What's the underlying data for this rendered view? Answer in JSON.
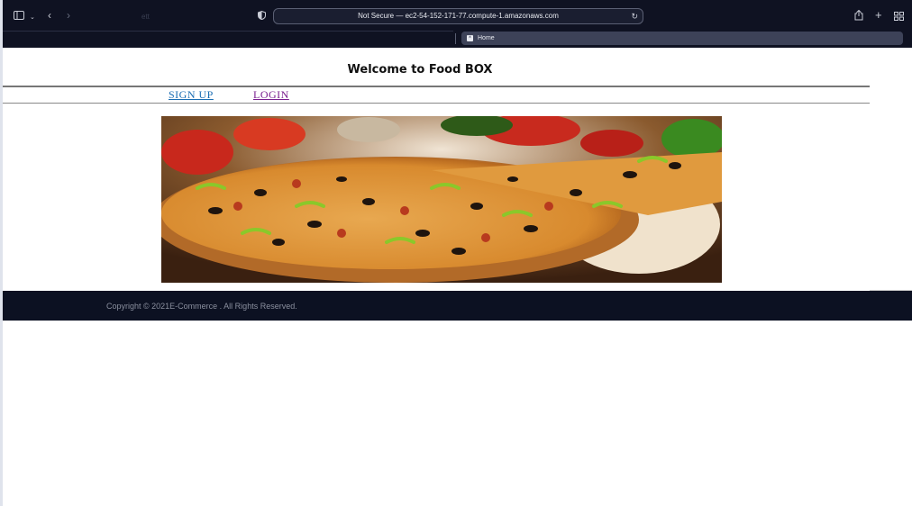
{
  "browser": {
    "address": "Not Secure — ec2-54-152-171-77.compute-1.amazonaws.com",
    "tab_title": "Home",
    "ghost_title": "ett"
  },
  "page": {
    "title": "Welcome to Food BOX",
    "nav": {
      "signup": "SIGN UP",
      "login": "LOGIN"
    },
    "hero_image": "pizza"
  },
  "footer": {
    "copyright": "Copyright © 2021E-Commerce . All Rights Reserved."
  }
}
